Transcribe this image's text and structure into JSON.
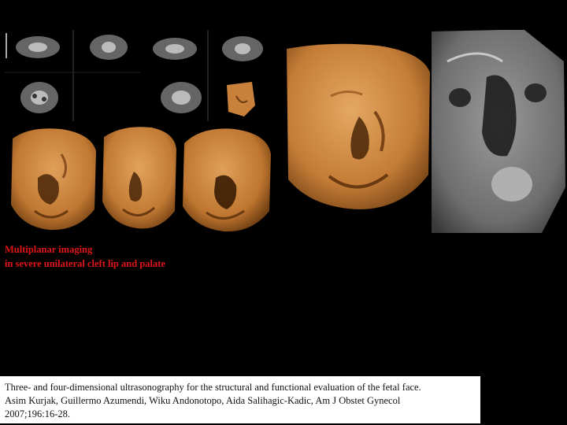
{
  "caption": {
    "line1": "Multiplanar imaging",
    "line2": "in severe unilateral cleft lip and palate"
  },
  "citation": {
    "line1": "Three- and four-dimensional ultrasonography for the structural and functional evaluation of the fetal face.",
    "line2": "Asim Kurjak, Guillermo Azumendi, Wiku Andonotopo, Aida Salihagic-Kadic, Am J Obstet Gynecol",
    "line3": "2007;196:16-28."
  },
  "colors": {
    "background": "#000000",
    "caption": "#e01515",
    "skin": "#c8803a",
    "skin_shadow": "#6a3a12",
    "ultrasound_gray": "#8a8a8a"
  },
  "images": [
    {
      "name": "ultrasound-thumbnails-left",
      "kind": "ultrasound-slices"
    },
    {
      "name": "ultrasound-thumbnails-right",
      "kind": "ultrasound-slices"
    },
    {
      "name": "fetal-face-render-1",
      "kind": "3d-surface-render"
    },
    {
      "name": "fetal-face-render-2",
      "kind": "3d-surface-render"
    },
    {
      "name": "fetal-face-render-3",
      "kind": "3d-surface-render"
    },
    {
      "name": "fetal-face-render-large",
      "kind": "3d-surface-render"
    },
    {
      "name": "fetal-face-grayscale-slice",
      "kind": "grayscale-ultrasound"
    }
  ]
}
